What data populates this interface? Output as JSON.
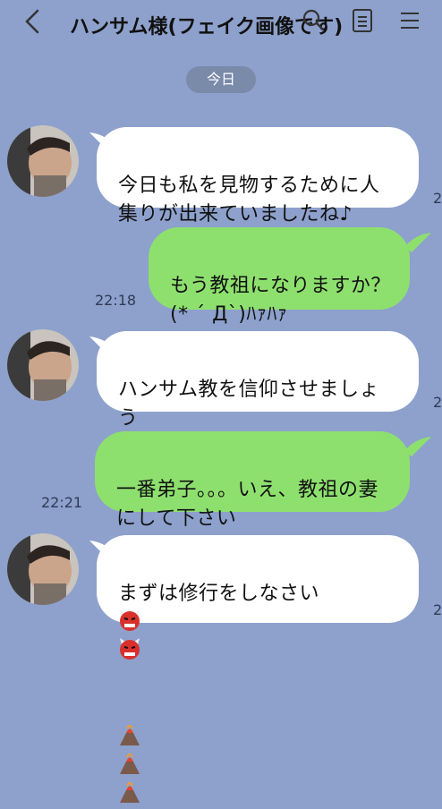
{
  "header": {
    "title": "ハンサム様(フェイク画像です)"
  },
  "date_divider": "今日",
  "messages": [
    {
      "side": "in",
      "text": "今日も私を見物するために人\n集りが出来ていましたね♪",
      "time": "2"
    },
    {
      "side": "out",
      "text": "もう教祖になりますか？\n(* ´ Д`)ﾊｧﾊｧ",
      "time": "22:18"
    },
    {
      "side": "in",
      "text": "ハンサム教を信仰させましょ\nう",
      "time": "2"
    },
    {
      "side": "out",
      "text": "一番弟子。。。いえ、教祖の妻\nにして下さい",
      "time": "22:21"
    },
    {
      "side": "in",
      "text": "まずは修行をしなさい",
      "time": "2"
    }
  ],
  "icons": [
    "back-icon",
    "search-icon",
    "notes-icon",
    "menu-icon",
    "heart-icon",
    "heart-eyes-cat-icon",
    "ogre-icon",
    "volcano-icon"
  ],
  "colors": {
    "background": "#8da1cc",
    "incoming_bubble": "#ffffff",
    "outgoing_bubble": "#8ee06e",
    "date_pill": "#7a8aa9"
  }
}
